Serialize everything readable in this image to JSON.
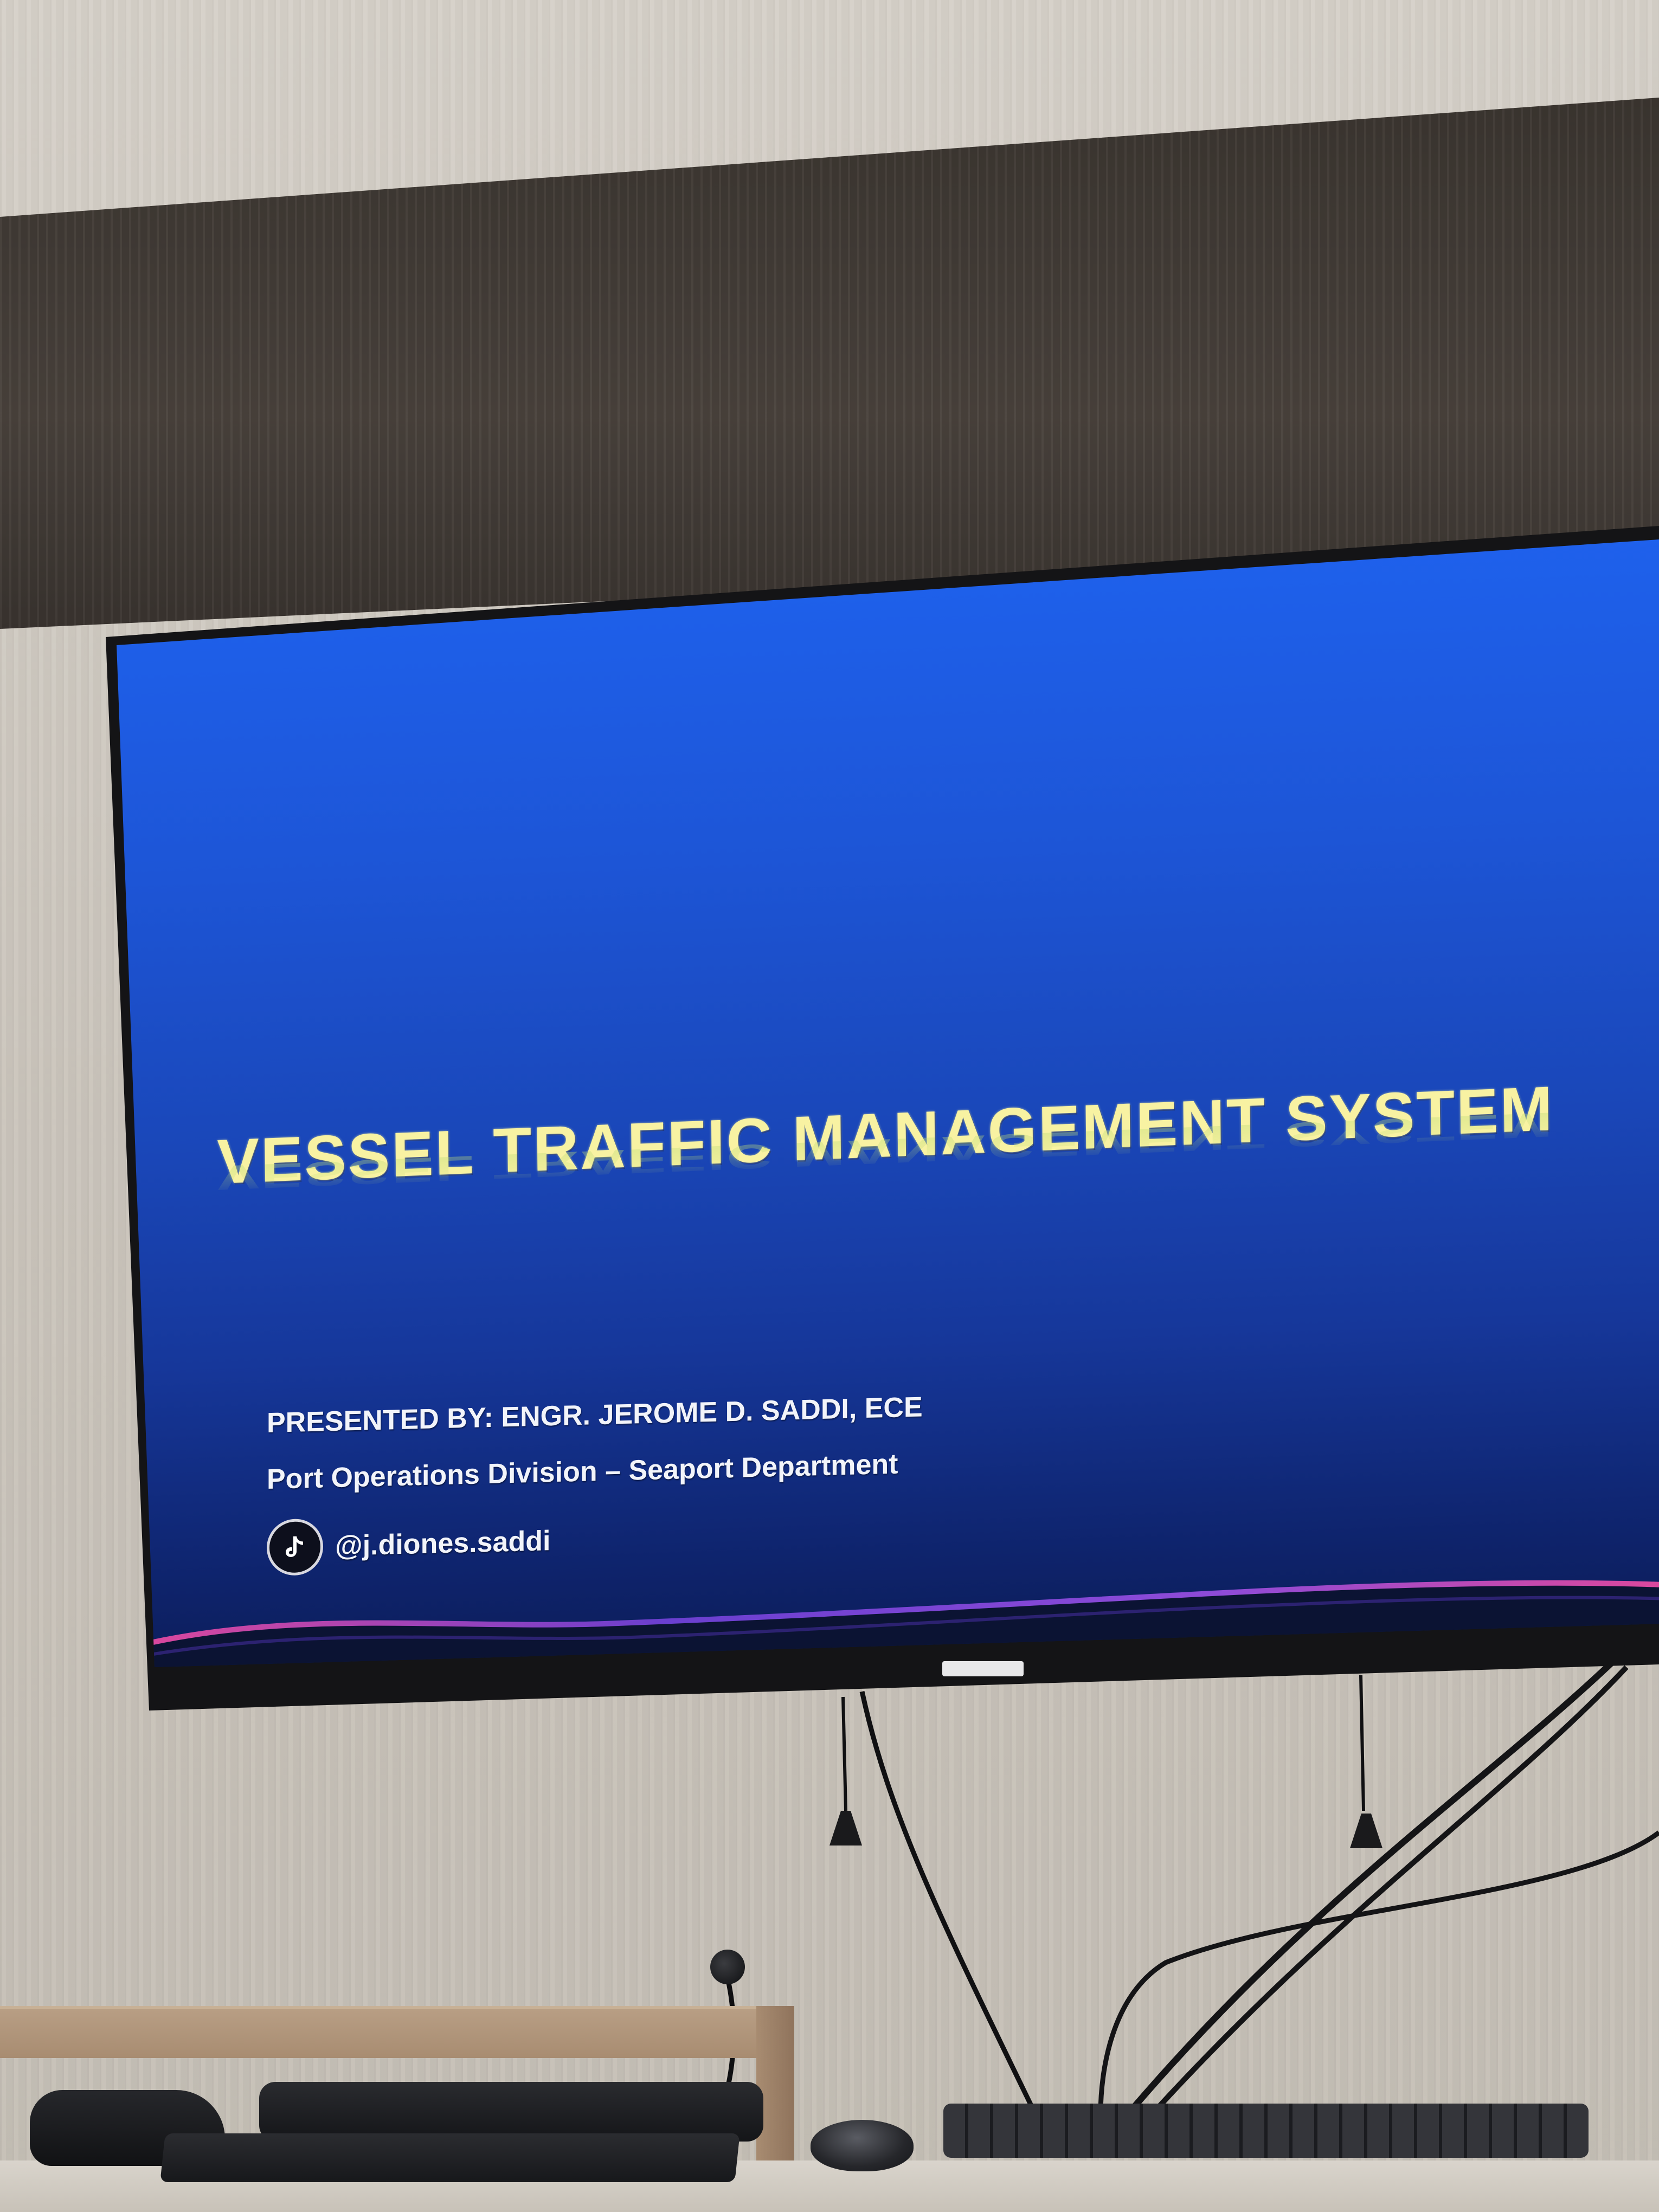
{
  "slide": {
    "title": "VESSEL TRAFFIC MANAGEMENT SYSTEM",
    "presenter": "PRESENTED BY: ENGR. JEROME D. SADDI, ECE",
    "department": "Port Operations Division – Seaport Department",
    "social_handle": "@j.diones.saddi",
    "social_icon": "tiktok-icon"
  },
  "colors": {
    "slide_background": "#1d55d6",
    "title_text": "#f8f2a2",
    "body_text": "#f2f4fa",
    "wave_pink": "#e0489a",
    "wave_purple": "#6a3fd0"
  }
}
